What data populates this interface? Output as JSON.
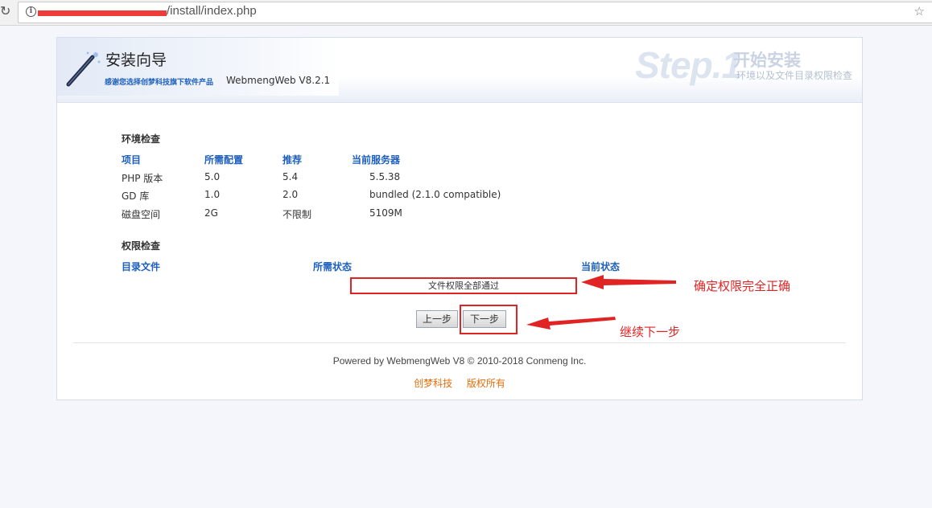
{
  "browser": {
    "url_visible": "/install/index.php"
  },
  "header": {
    "title": "安装向导",
    "subtitle": "感谢您选择创梦科技旗下软件产品",
    "version": "WebmengWeb V8.2.1",
    "step_label": "Step.1",
    "step_title": "开始安装",
    "step_subtitle": "环境以及文件目录权限检查"
  },
  "env_check": {
    "title": "环境检查",
    "columns": [
      "项目",
      "所需配置",
      "推荐",
      "当前服务器"
    ],
    "rows": [
      [
        "PHP 版本",
        "5.0",
        "5.4",
        "5.5.38"
      ],
      [
        "GD 库",
        "1.0",
        "2.0",
        "bundled (2.1.0 compatible)"
      ],
      [
        "磁盘空间",
        "2G",
        "不限制",
        "5109M"
      ]
    ]
  },
  "perm_check": {
    "title": "权限检查",
    "columns": [
      "目录文件",
      "所需状态",
      "当前状态"
    ],
    "status_message": "文件权限全部通过"
  },
  "buttons": {
    "prev": "上一步",
    "next": "下一步"
  },
  "footer": {
    "powered": "Powered by WebmengWeb V8 © 2010-2018 Conmeng Inc.",
    "links": [
      "创梦科技",
      "版权所有"
    ]
  },
  "annotations": {
    "perm_note": "确定权限完全正确",
    "next_note": "继续下一步",
    "color": "#e02424"
  },
  "colors": {
    "accent_blue": "#1d5fbd",
    "footer_orange": "#e36c0a"
  }
}
